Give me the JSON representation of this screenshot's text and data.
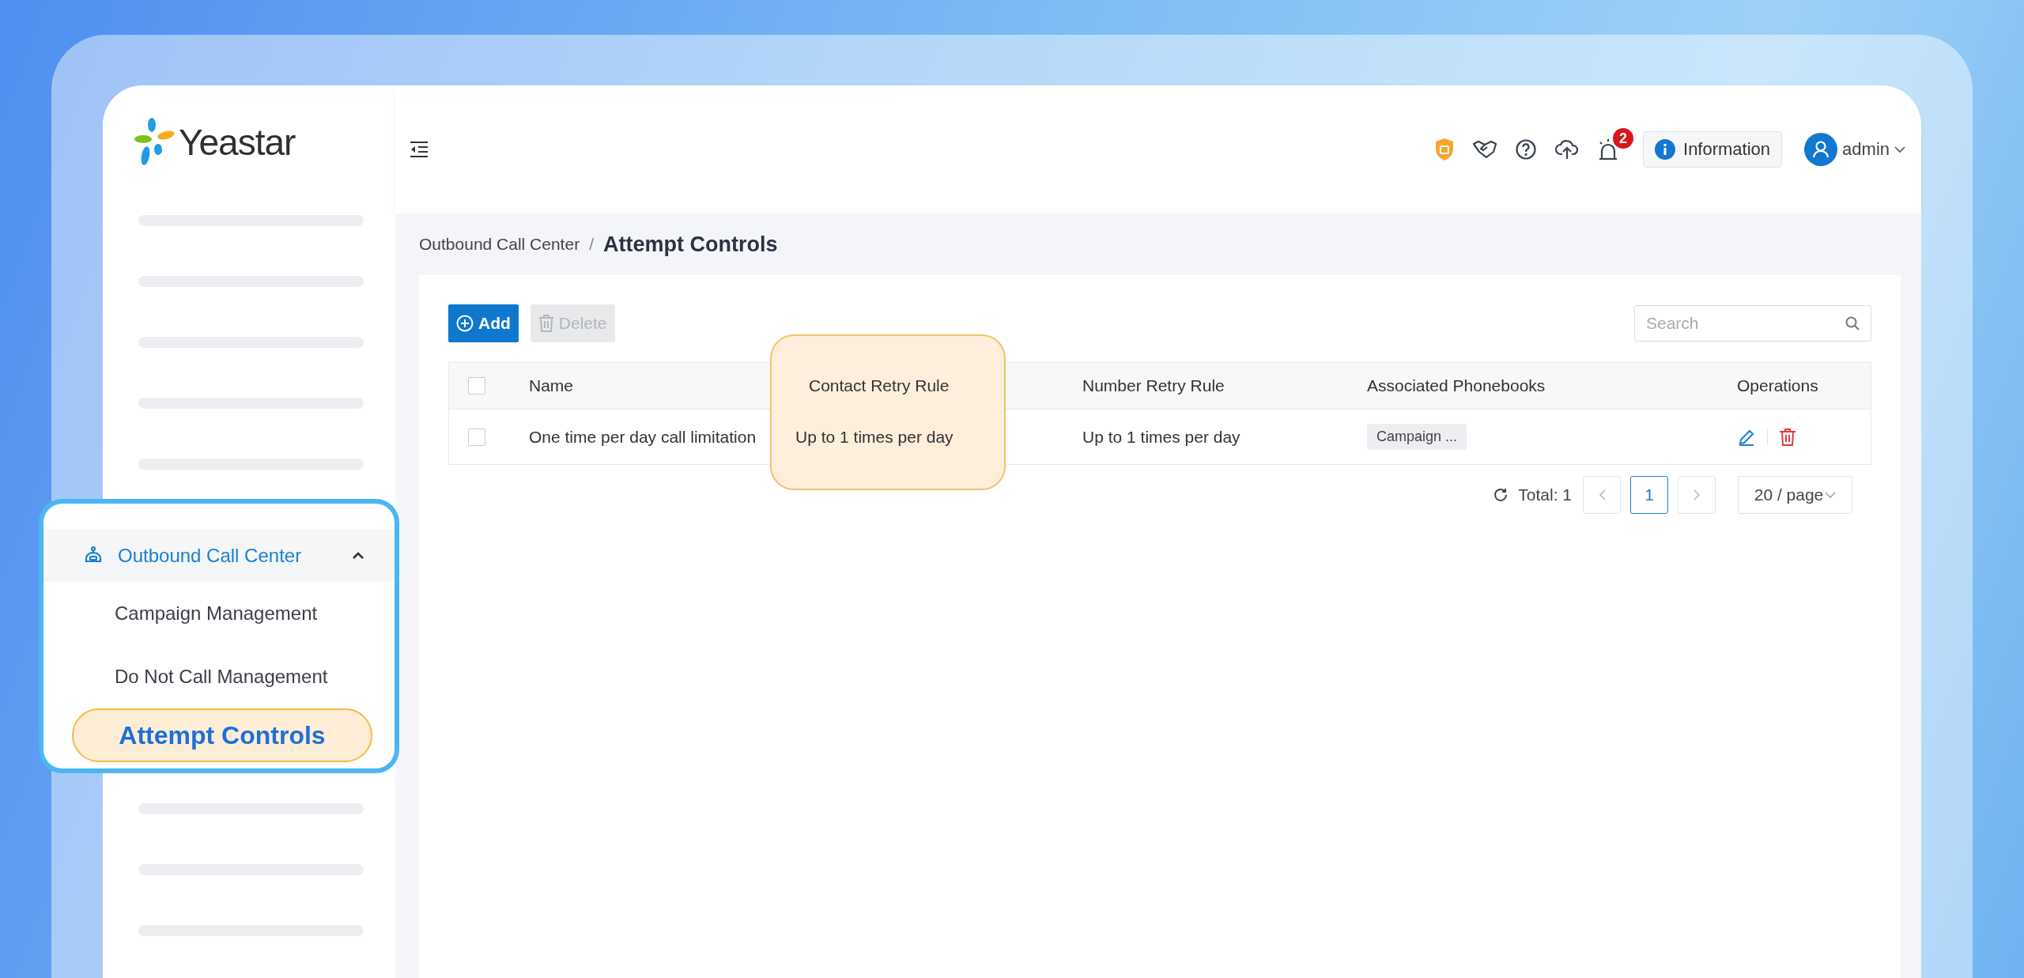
{
  "logo": {
    "text": "Yeastar"
  },
  "sidebar": {
    "group": {
      "label": "Outbound Call Center",
      "expanded": true,
      "items": [
        {
          "label": "Campaign Management",
          "selected": false
        },
        {
          "label": "Do Not Call Management",
          "selected": false
        },
        {
          "label": "Attempt Controls",
          "selected": true
        }
      ]
    }
  },
  "header": {
    "notification_badge": "2",
    "info_button": "Information",
    "user": "admin"
  },
  "breadcrumb": {
    "parent": "Outbound Call Center",
    "separator": "/",
    "current": "Attempt Controls"
  },
  "toolbar": {
    "buttons": [
      {
        "kind": "add",
        "label": "Add",
        "disabled": false
      },
      {
        "kind": "delete",
        "label": "Delete",
        "disabled": true
      }
    ],
    "search": {
      "placeholder": "Search"
    }
  },
  "table": {
    "select_all": {
      "checked": false
    },
    "columns": [
      {
        "kind": "text",
        "label": "Name",
        "highlighted": false
      },
      {
        "kind": "text",
        "label": "Contact Retry Rule",
        "highlighted": true
      },
      {
        "kind": "text",
        "label": "Number Retry Rule",
        "highlighted": false
      },
      {
        "kind": "tags",
        "label": "Associated Phonebooks",
        "highlighted": false
      },
      {
        "kind": "operations",
        "label": "Operations",
        "highlighted": false
      }
    ],
    "rows": [
      {
        "checked": false,
        "cells": [
          "One time per day call limitation",
          "Up to 1 times per day",
          "Up to 1 times per day"
        ],
        "phonebooks": [
          "Campaign ..."
        ]
      }
    ]
  },
  "pagination": {
    "total": "Total: 1",
    "pages": [
      {
        "label": "1",
        "selected": true
      }
    ],
    "page_size": "20 / page"
  }
}
